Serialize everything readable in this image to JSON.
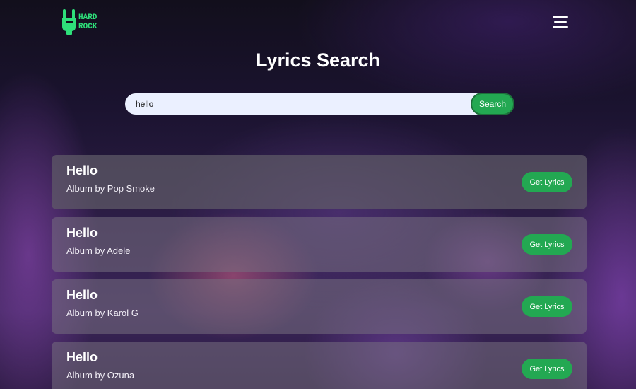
{
  "header": {
    "logo_text": "HARD ROCK",
    "logo_line1": "HARD",
    "logo_line2": "ROCK",
    "menu_icon": "hamburger-menu-icon"
  },
  "page": {
    "title": "Lyrics Search"
  },
  "search": {
    "value": "hello",
    "button_label": "Search"
  },
  "results": [
    {
      "title": "Hello",
      "subtitle": "Album by Pop Smoke",
      "button_label": "Get Lyrics"
    },
    {
      "title": "Hello",
      "subtitle": "Album by Adele",
      "button_label": "Get Lyrics"
    },
    {
      "title": "Hello",
      "subtitle": "Album by Karol G",
      "button_label": "Get Lyrics"
    },
    {
      "title": "Hello",
      "subtitle": "Album by Ozuna",
      "button_label": "Get Lyrics"
    }
  ],
  "colors": {
    "accent_green": "#23a852",
    "logo_green": "#2ee07a",
    "search_field": "#ebf0ff",
    "card_bg": "#6e6a7a"
  }
}
